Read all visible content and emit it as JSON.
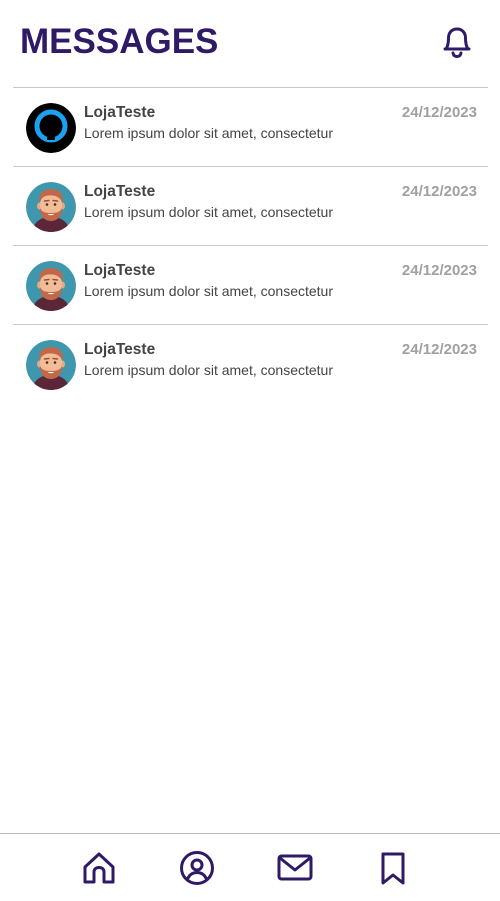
{
  "header": {
    "title": "MESSAGES",
    "icon": "bell-icon"
  },
  "colors": {
    "accent": "#2f1a66",
    "text": "#444444",
    "date": "#a0a0a0",
    "divider": "#c9c9c9"
  },
  "messages": [
    {
      "sender": "LojaTeste",
      "preview": "Lorem ipsum dolor sit amet, consectetur",
      "date": "24/12/2023",
      "avatar": "keyhole-avatar"
    },
    {
      "sender": "LojaTeste",
      "preview": "Lorem ipsum dolor sit amet, consectetur",
      "date": "24/12/2023",
      "avatar": "bearded-man-avatar"
    },
    {
      "sender": "LojaTeste",
      "preview": "Lorem ipsum dolor sit amet, consectetur",
      "date": "24/12/2023",
      "avatar": "bearded-man-avatar"
    },
    {
      "sender": "LojaTeste",
      "preview": "Lorem ipsum dolor sit amet, consectetur",
      "date": "24/12/2023",
      "avatar": "bearded-man-avatar"
    }
  ],
  "bottom_nav": [
    {
      "icon": "home-icon"
    },
    {
      "icon": "profile-icon"
    },
    {
      "icon": "mail-icon"
    },
    {
      "icon": "bookmark-icon"
    }
  ]
}
